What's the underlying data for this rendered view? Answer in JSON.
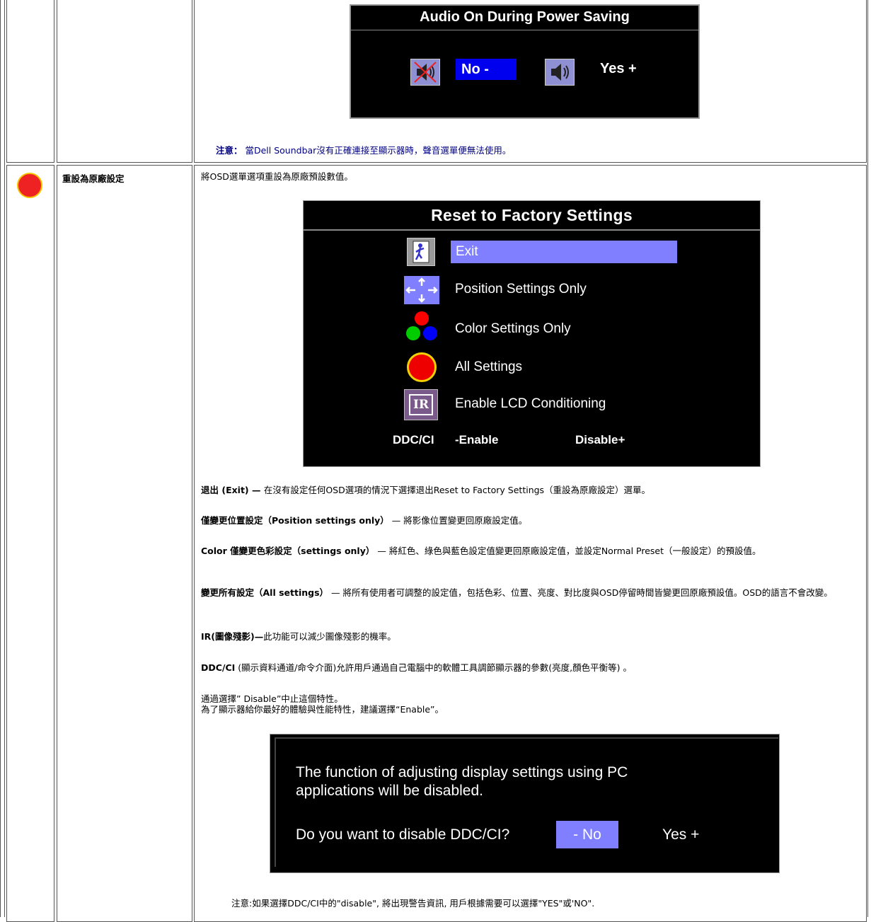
{
  "audio_osd": {
    "title": "Audio On During Power Saving",
    "no": "No -",
    "yes": "Yes +"
  },
  "note1": {
    "label": "注意：",
    "text": " 當Dell Soundbar沒有正確連接至顯示器時，聲音選單便無法使用。"
  },
  "reset": {
    "name": "重設為原廠設定",
    "desc": "將OSD選單選項重設為原廠預設數值。"
  },
  "reset_osd": {
    "title": "Reset to Factory Settings",
    "items": [
      "Exit",
      "Position Settings Only",
      "Color Settings Only",
      "All Settings",
      "Enable LCD Conditioning"
    ],
    "ddc": "DDC/CI",
    "enable": "-Enable",
    "disable": "Disable+"
  },
  "paras": {
    "exit_b": "退出 (Exit) — ",
    "exit_t": "在沒有設定任何OSD選項的情況下選擇退出Reset to Factory Settings（重設為原廠設定）選單。",
    "pos_b": "僅變更位置設定（Position settings only）",
    "pos_t": " — 將影像位置變更回原廠設定值。",
    "color_b": "Color 僅變更色彩設定（settings only）",
    "color_t": " — 將紅色、綠色與藍色設定值變更回原廠設定值，並設定Normal Preset（一般設定）的預設值。",
    "all_b": "變更所有設定（All settings）",
    "all_t": " — 將所有使用者可調整的設定值，包括色彩、位置、亮度、對比度與OSD停留時間皆變更回原廠預設值。OSD的語言不會改變。",
    "ir_b": "IR(圖像殘影)—",
    "ir_t": "此功能可以減少圖像殘影的機率。",
    "ddc_b": "DDC/CI",
    "ddc_t": " (顯示資料通道/命令介面)允許用戶通過自己電腦中的軟體工具調節顯示器的參數(亮度,顏色平衡等) 。",
    "dis1": "通過選擇” Disable”中止這個特性。",
    "dis2": "為了顯示器給你最好的體驗與性能特性，建議選擇“Enable”。"
  },
  "ddc_osd": {
    "line1": "The function of adjusting display settings using PC",
    "line2": "applications will be disabled.",
    "question": "Do you want to disable DDC/CI?",
    "no": "- No",
    "yes": "Yes +"
  },
  "note2": "注意:如果選擇DDC/CI中的\"disable\", 將出現警告資訊, 用戶根據需要可以選擇\"YES\"或'NO\"."
}
